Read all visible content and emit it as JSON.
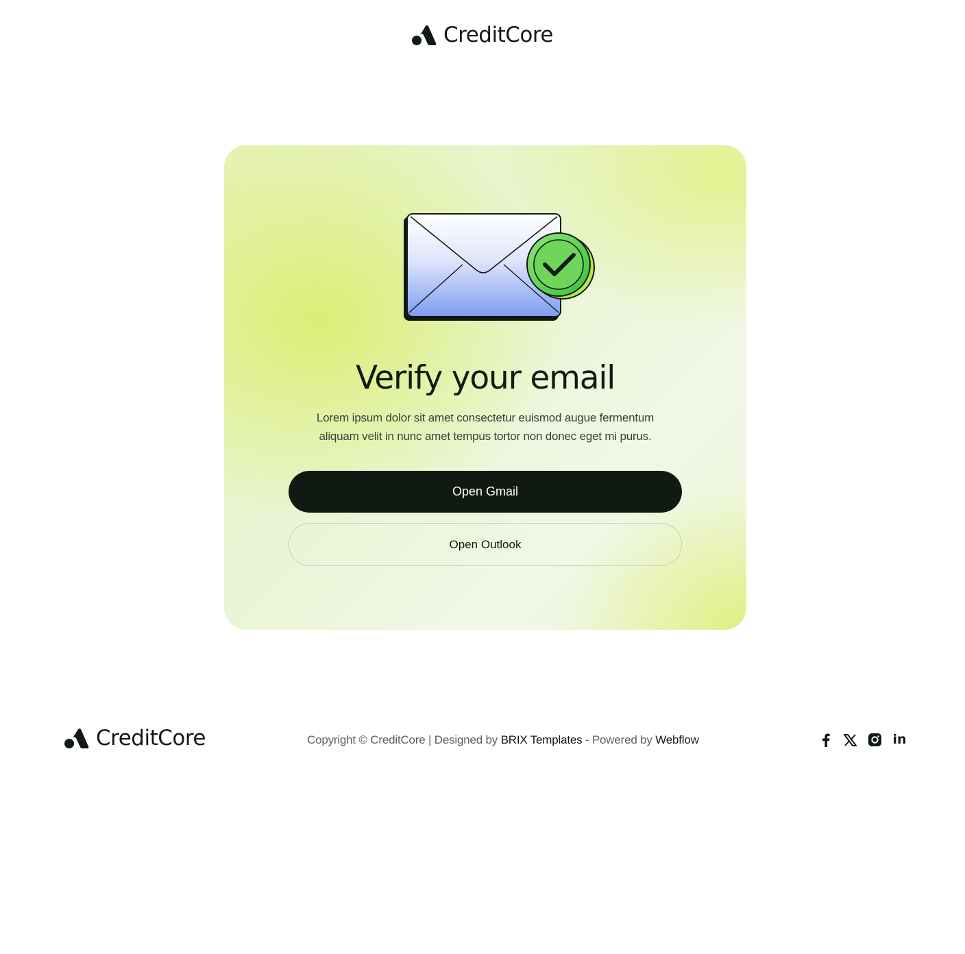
{
  "brand": {
    "name": "CreditCore",
    "color_dark": "#111a12",
    "accent_green": "#4cc83c",
    "accent_lime": "#dcef6f"
  },
  "card": {
    "title": "Verify your email",
    "description": "Lorem ipsum dolor sit amet consectetur euismod augue fermentum aliquam velit in nunc amet tempus tortor non donec eget mi purus.",
    "illustration": "envelope-with-checkmark-icon",
    "primary_button": "Open Gmail",
    "secondary_button": "Open Outlook"
  },
  "footer": {
    "copyright_prefix": "Copyright © CreditCore | Designed by ",
    "designer": "BRIX Templates",
    "powered_prefix": " - Powered by ",
    "platform": "Webflow",
    "social": [
      {
        "icon": "facebook-icon"
      },
      {
        "icon": "x-twitter-icon"
      },
      {
        "icon": "instagram-icon"
      },
      {
        "icon": "linkedin-icon",
        "text": "in"
      }
    ]
  }
}
